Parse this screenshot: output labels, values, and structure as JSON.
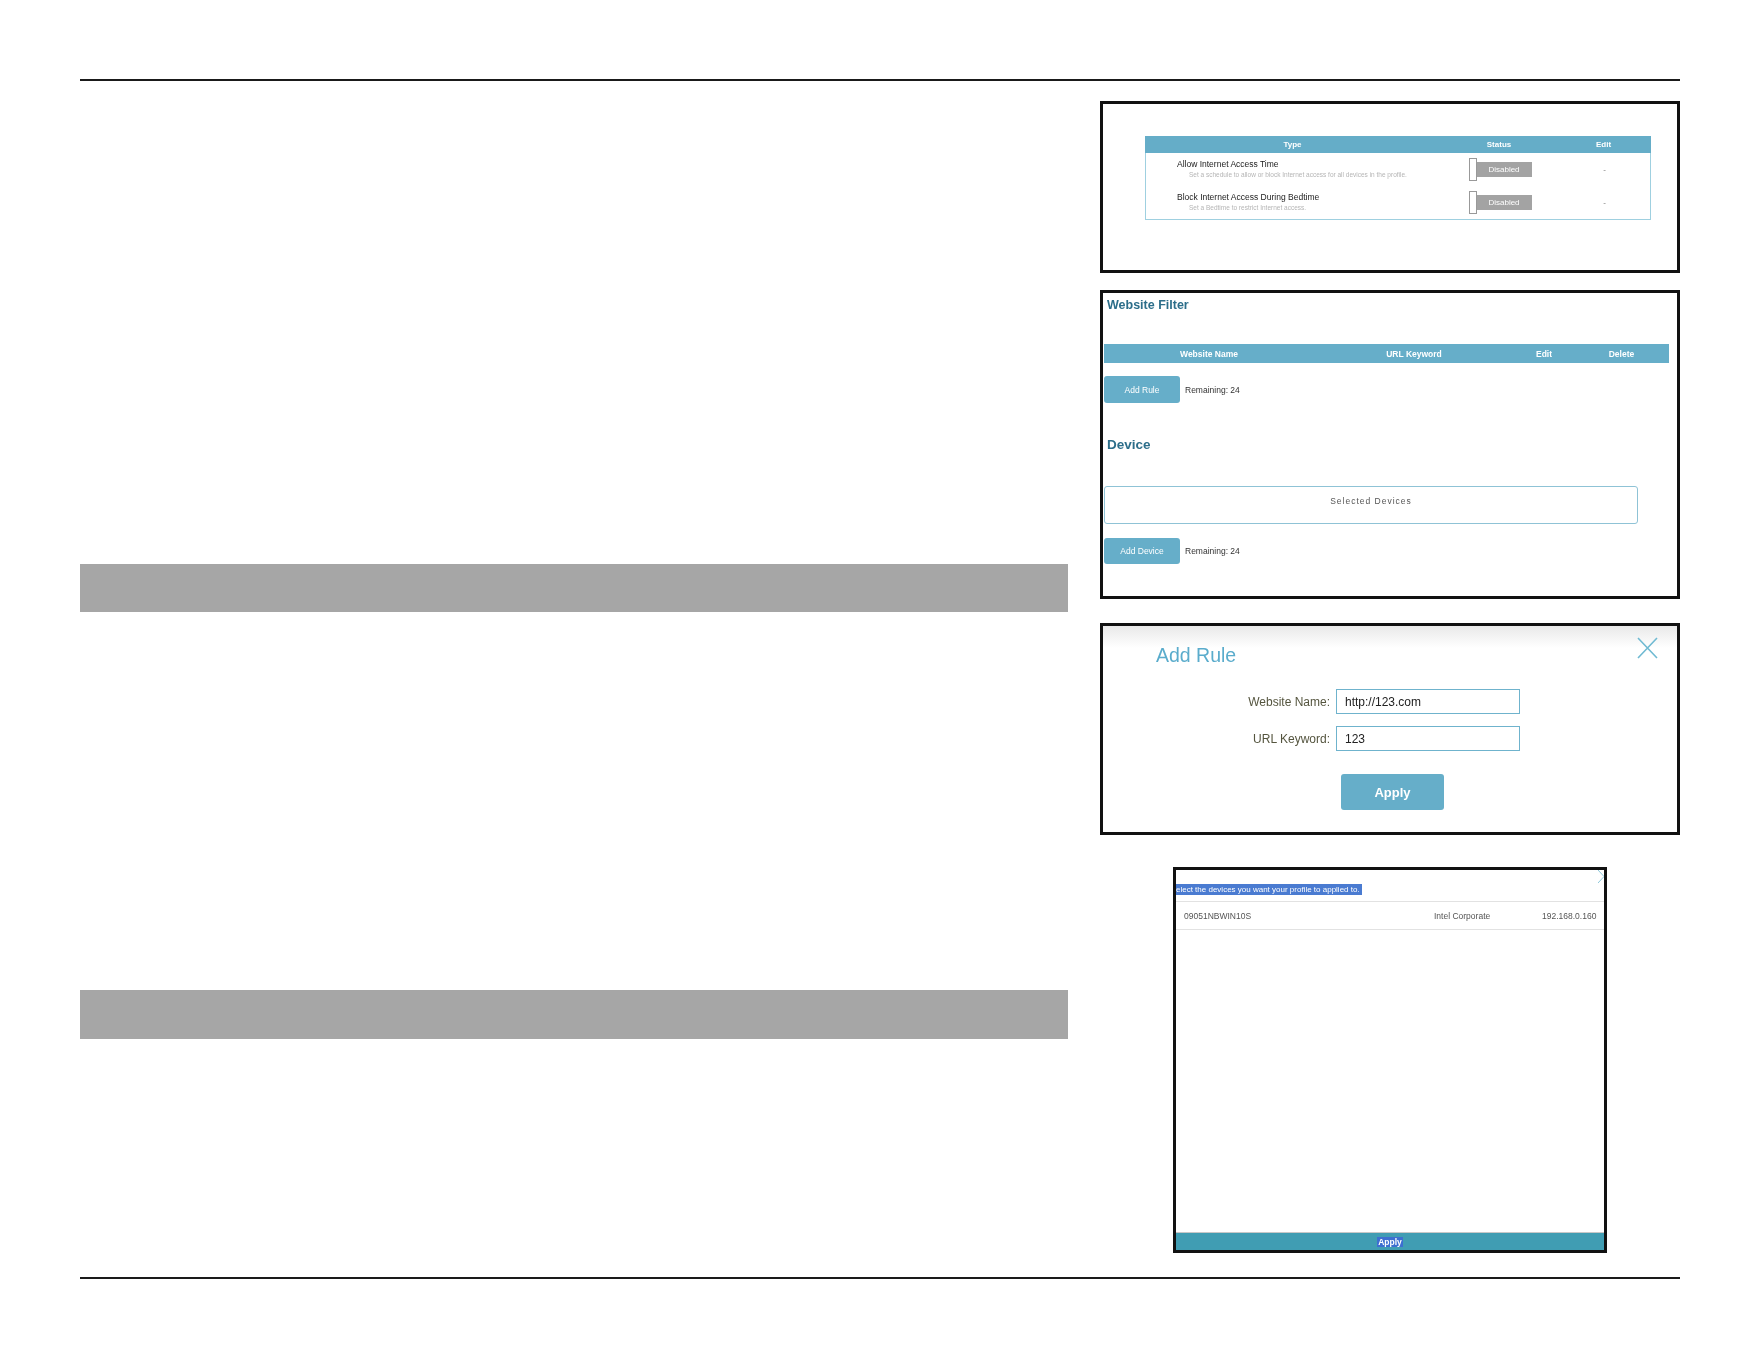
{
  "access_schedule": {
    "columns": [
      "Type",
      "Status",
      "Edit"
    ],
    "rows": [
      {
        "title": "Allow Internet Access Time",
        "description": "Set a schedule to allow or block Internet access for all devices in the profile.",
        "status": "Disabled",
        "on": false,
        "edit": "-"
      },
      {
        "title": "Block Internet Access During Bedtime",
        "description": "Set a Bedtime to restrict Internet access.",
        "status": "Disabled",
        "on": false,
        "edit": "-"
      }
    ]
  },
  "website_filter": {
    "title": "Website Filter",
    "columns": [
      "Website Name",
      "URL Keyword",
      "Edit",
      "Delete"
    ],
    "add_button": "Add Rule",
    "remaining": "Remaining: 24"
  },
  "device": {
    "title": "Device",
    "selected_devices": "Selected Devices",
    "add_button": "Add Device",
    "remaining": "Remaining: 24"
  },
  "add_rule_dialog": {
    "title": "Add Rule",
    "fields": [
      {
        "label": "Website Name:",
        "value": "http://123.com"
      },
      {
        "label": "URL Keyword:",
        "value": "123"
      }
    ],
    "apply_button": "Apply"
  },
  "device_picker": {
    "prompt": {
      "text": "elect the devices you want your profile to applied to.",
      "highlighted": true
    },
    "devices": [
      {
        "name": "09051NBWIN10S",
        "vendor": "Intel Corporate",
        "ip": "192.168.0.160"
      }
    ],
    "apply_button": {
      "label": "Apply",
      "highlighted": true
    }
  }
}
